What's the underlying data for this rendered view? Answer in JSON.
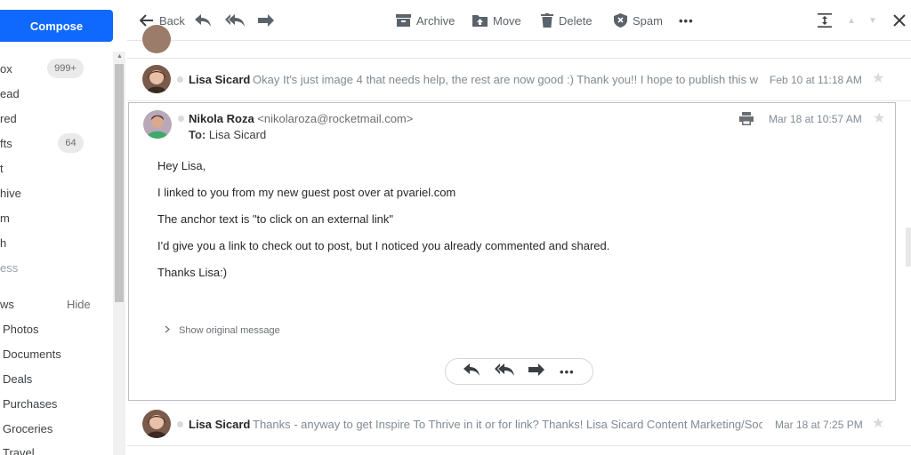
{
  "sidebar": {
    "compose_label": "Compose",
    "items": [
      {
        "label": "ox",
        "count": "999+"
      },
      {
        "label": "ead"
      },
      {
        "label": "red"
      },
      {
        "label": "fts",
        "count": "64"
      },
      {
        "label": "t"
      },
      {
        "label": "hive"
      },
      {
        "label": "m"
      },
      {
        "label": "h"
      },
      {
        "label": "ess"
      }
    ],
    "views": {
      "label": "ws",
      "hide_label": "Hide"
    },
    "view_items": [
      {
        "label": "Photos"
      },
      {
        "label": "Documents"
      },
      {
        "label": "Deals"
      },
      {
        "label": "Purchases"
      },
      {
        "label": "Groceries"
      },
      {
        "label": "Travel"
      }
    ]
  },
  "toolbar": {
    "back_label": "Back",
    "archive_label": "Archive",
    "move_label": "Move",
    "delete_label": "Delete",
    "spam_label": "Spam",
    "more_label": "•••"
  },
  "messages": [
    {
      "sender": "Lisa Sicard",
      "snippet": "Okay It's just image 4 that needs help, the rest are now good :) Thank you!! I hope to publish this w",
      "date": "Feb 10 at 11:18 AM"
    },
    {
      "sender": "Lisa Sicard",
      "snippet": "Thanks - anyway to get Inspire To Thrive in it or for link? Thanks! Lisa Sicard Content Marketing/Soc",
      "date": "Mar 18 at 7:25 PM"
    }
  ],
  "open_message": {
    "sender": "Nikola Roza",
    "email": "<nikolaroza@rocketmail.com>",
    "to_prefix": "To:",
    "to_name": "Lisa Sicard",
    "date": "Mar 18 at 10:57 AM",
    "body": [
      "Hey Lisa,",
      "I linked to you from my new guest post over at pvariel.com",
      "The anchor text is \"to click on an external link\"",
      "I'd give you a link to check out to post, but I noticed you already commented and shared.",
      "Thanks Lisa:)"
    ],
    "show_original_label": "Show original message",
    "more_label": "•••"
  },
  "colors": {
    "accent": "#0f69ff",
    "icon": "#5b636a"
  }
}
